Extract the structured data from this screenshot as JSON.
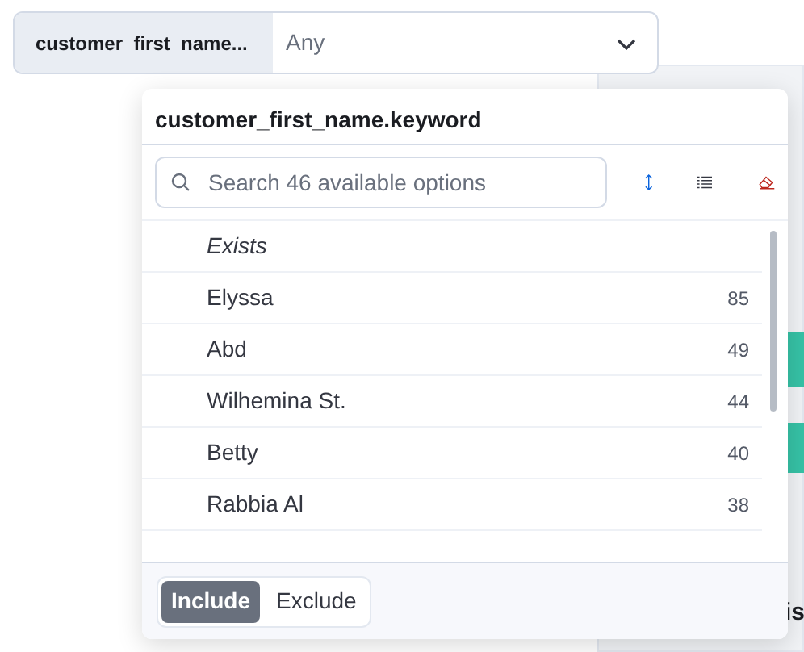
{
  "filter": {
    "label": "customer_first_name...",
    "value": "Any"
  },
  "popover": {
    "title": "customer_first_name.keyword",
    "search": {
      "placeholder": "Search 46 available options"
    },
    "options": [
      {
        "kind": "exists",
        "label": "Exists"
      },
      {
        "kind": "value",
        "label": "Elyssa",
        "count": "85"
      },
      {
        "kind": "value",
        "label": "Abd",
        "count": "49"
      },
      {
        "kind": "value",
        "label": "Wilhemina St.",
        "count": "44"
      },
      {
        "kind": "value",
        "label": "Betty",
        "count": "40"
      },
      {
        "kind": "value",
        "label": "Rabbia Al",
        "count": "38"
      }
    ],
    "modes": [
      {
        "label": "Include",
        "selected": true
      },
      {
        "label": "Exclude",
        "selected": false
      }
    ]
  },
  "background": {
    "text": "is"
  }
}
